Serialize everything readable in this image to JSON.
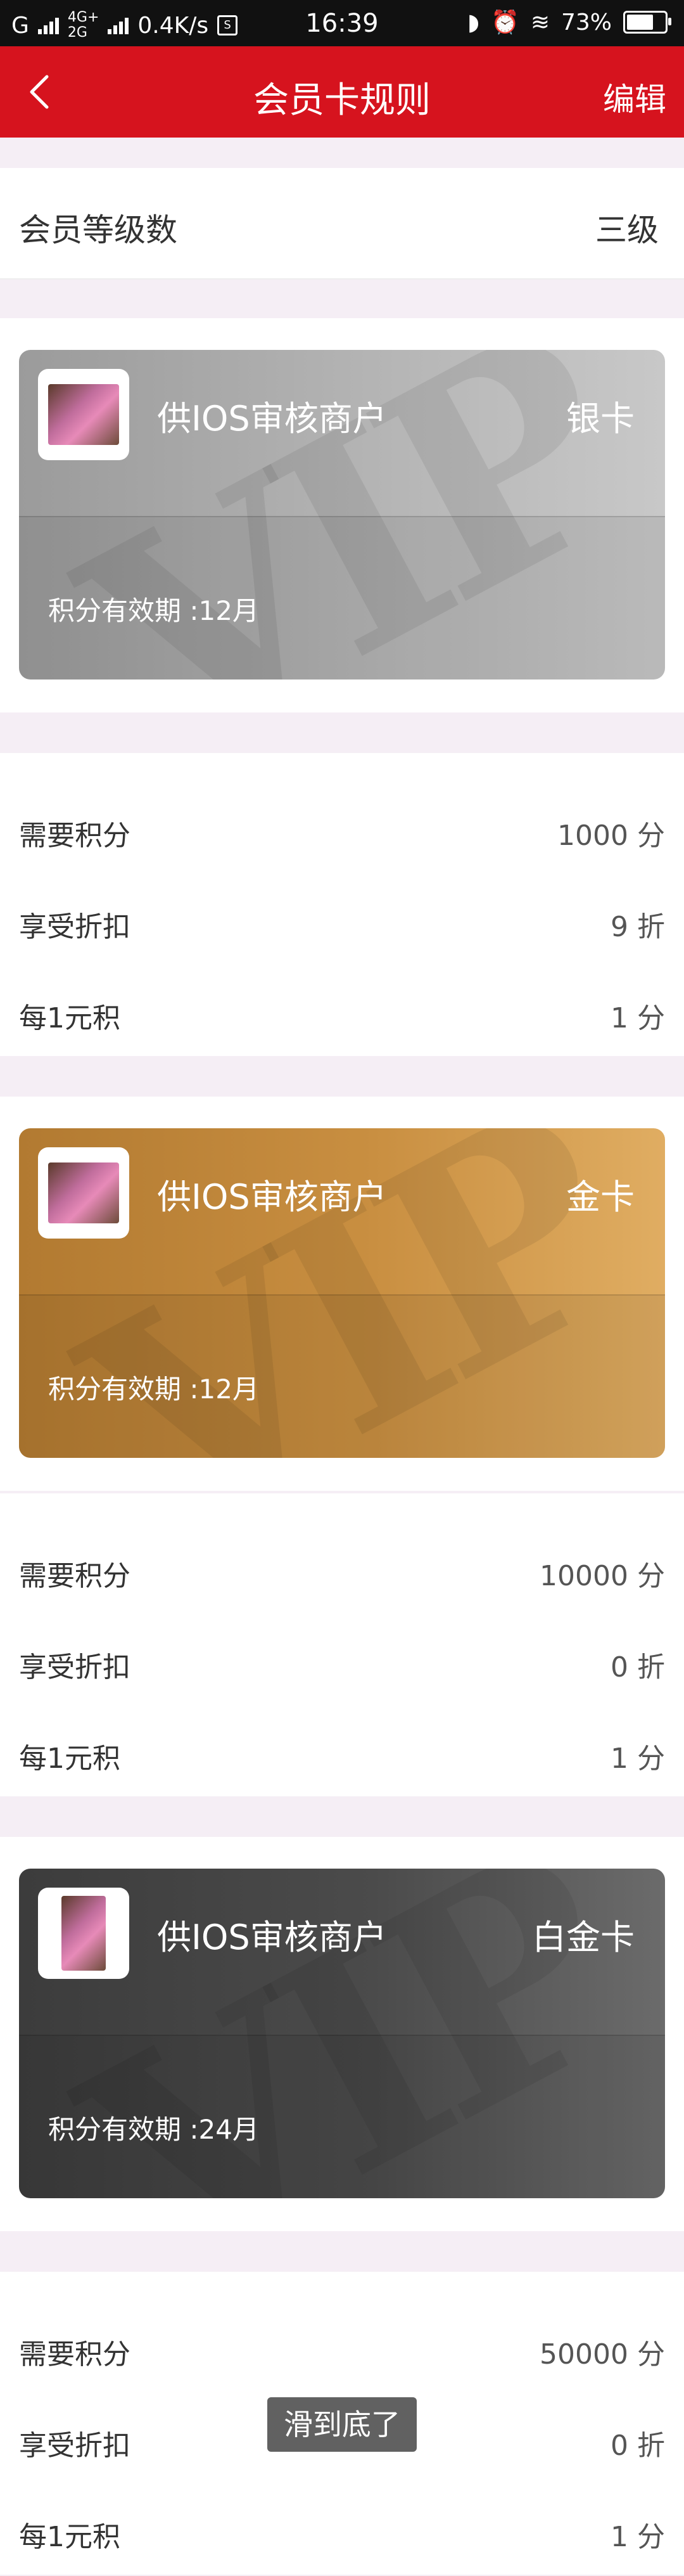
{
  "status": {
    "carrier": "G",
    "net1": "4G+",
    "net2": "2G",
    "speed": "0.4K/s",
    "time": "16:39",
    "battery": "73%",
    "battery_level": 0.73
  },
  "nav": {
    "title": "会员卡规则",
    "edit_label": "编辑"
  },
  "level": {
    "label": "会员等级数",
    "value": "三级"
  },
  "cards": [
    {
      "merchant": "供IOS审核商户",
      "tier": "银卡",
      "validity": "积分有效期 :12月",
      "watermark": "VIP",
      "rows": [
        {
          "k": "需要积分",
          "v": "1000 分"
        },
        {
          "k": "享受折扣",
          "v": "9 折"
        },
        {
          "k": "每1元积",
          "v": "1 分"
        }
      ]
    },
    {
      "merchant": "供IOS审核商户",
      "tier": "金卡",
      "validity": "积分有效期 :12月",
      "watermark": "VIP",
      "rows": [
        {
          "k": "需要积分",
          "v": "10000 分"
        },
        {
          "k": "享受折扣",
          "v": "0 折"
        },
        {
          "k": "每1元积",
          "v": "1 分"
        }
      ]
    },
    {
      "merchant": "供IOS审核商户",
      "tier": "白金卡",
      "validity": "积分有效期 :24月",
      "watermark": "VIP",
      "rows": [
        {
          "k": "需要积分",
          "v": "50000 分"
        },
        {
          "k": "享受折扣",
          "v": "0 折"
        },
        {
          "k": "每1元积",
          "v": "1 分"
        }
      ]
    }
  ],
  "toast": "滑到底了",
  "colors": {
    "navbar": "#d6131e",
    "silver": "#b2b2b2",
    "gold": "#c98f41",
    "platinum": "#4b4b4b"
  }
}
